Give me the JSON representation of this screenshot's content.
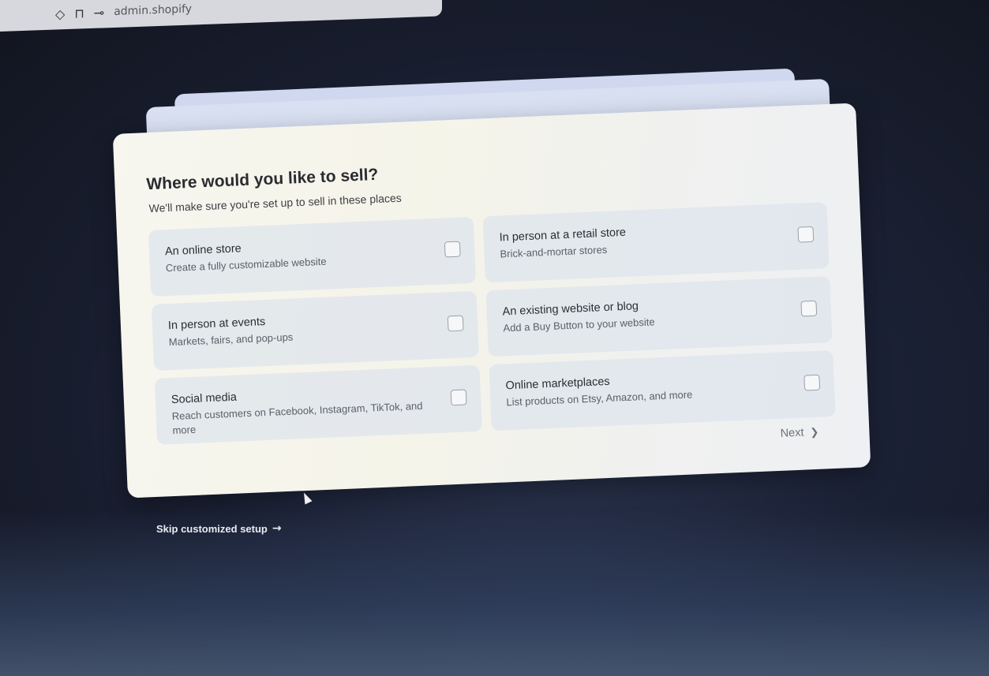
{
  "browser": {
    "url_fragment": "admin.shopify"
  },
  "card": {
    "title": "Where would you like to sell?",
    "subtitle": "We'll make sure you're set up to sell in these places"
  },
  "options": [
    {
      "title": "An online store",
      "description": "Create a fully customizable website",
      "checked": false
    },
    {
      "title": "In person at a retail store",
      "description": "Brick-and-mortar stores",
      "checked": false
    },
    {
      "title": "In person at events",
      "description": "Markets, fairs, and pop-ups",
      "checked": false
    },
    {
      "title": "An existing website or blog",
      "description": "Add a Buy Button to your website",
      "checked": false
    },
    {
      "title": "Social media",
      "description": "Reach customers on Facebook, Instagram, TikTok, and more",
      "checked": false
    },
    {
      "title": "Online marketplaces",
      "description": "List products on Etsy, Amazon, and more",
      "checked": false
    }
  ],
  "next_label": "Next",
  "skip_label": "Skip customized setup",
  "icons": {
    "next": "chevron-right-icon",
    "skip": "arrow-right-icon",
    "shield": "shield-icon",
    "lock": "lock-icon",
    "key": "key-icon"
  }
}
